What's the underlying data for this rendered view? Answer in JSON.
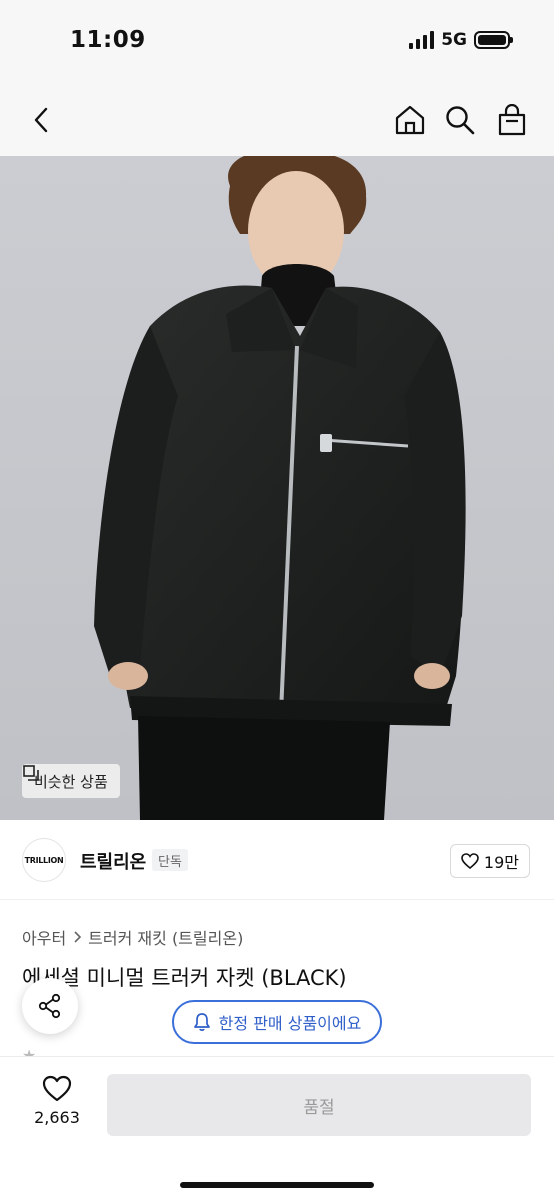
{
  "status_bar": {
    "time": "11:09",
    "network": "5G"
  },
  "nav": {
    "back_icon": "chevron-left-icon",
    "home_icon": "home-icon",
    "search_icon": "search-icon",
    "bag_icon": "shopping-bag-icon"
  },
  "hero": {
    "similar_label": "비슷한 상품"
  },
  "brand": {
    "logo_text": "TRILLION",
    "name": "트릴리온",
    "tag": "단독",
    "like_count": "19만"
  },
  "product": {
    "breadcrumb": [
      "아우터",
      "트러커 재킷 (트릴리온)"
    ],
    "title": "에세셜 미니멀 트러커 자켓 (BLACK)",
    "limited_label": "한정 판매 상품이에요"
  },
  "bottom": {
    "like_count": "2,663",
    "soldout_label": "품절"
  },
  "colors": {
    "accent_blue": "#3b6fd9",
    "soldout_bg": "#e8e8ea"
  }
}
